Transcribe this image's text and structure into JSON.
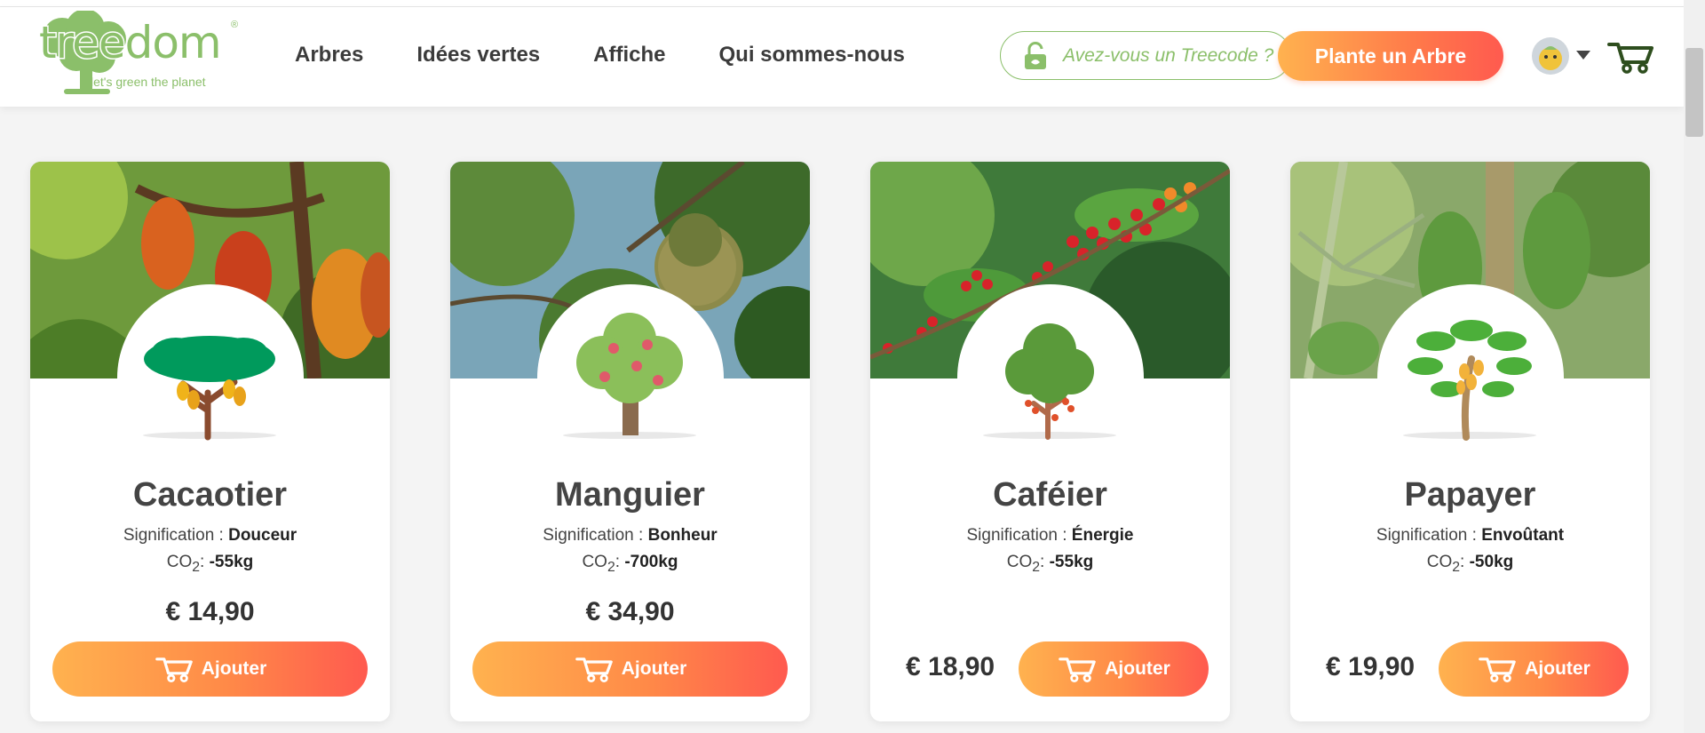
{
  "brand": {
    "name": "treedom",
    "tagline": "let's green the planet",
    "registered": "®",
    "color": "#8bbf6a"
  },
  "nav": {
    "items": [
      "Arbres",
      "Idées vertes",
      "Affiche",
      "Qui sommes-nous"
    ]
  },
  "header": {
    "treecode_label": "Avez-vous un Treecode ?",
    "plant_button": "Plante un Arbre",
    "accent": "#ff7a4a"
  },
  "cards": [
    {
      "name": "Cacaotier",
      "meaning_label": "Signification : ",
      "meaning": "Douceur",
      "co2_label": "CO",
      "co2_sub": "2",
      "co2_sep": ": ",
      "co2": "-55kg",
      "price": "€ 14,90",
      "button": "Ajouter",
      "icon": "cacao-tree-icon"
    },
    {
      "name": "Manguier",
      "meaning_label": "Signification : ",
      "meaning": "Bonheur",
      "co2_label": "CO",
      "co2_sub": "2",
      "co2_sep": ": ",
      "co2": "-700kg",
      "price": "€ 34,90",
      "button": "Ajouter",
      "icon": "mango-tree-icon"
    },
    {
      "name": "Caféier",
      "meaning_label": "Signification : ",
      "meaning": "Énergie",
      "co2_label": "CO",
      "co2_sub": "2",
      "co2_sep": ": ",
      "co2": "-55kg",
      "price": "€ 18,90",
      "button": "Ajouter",
      "icon": "coffee-tree-icon"
    },
    {
      "name": "Papayer",
      "meaning_label": "Signification : ",
      "meaning": "Envoûtant",
      "co2_label": "CO",
      "co2_sub": "2",
      "co2_sep": ": ",
      "co2": "-50kg",
      "price": "€ 19,90",
      "button": "Ajouter",
      "icon": "papaya-tree-icon"
    }
  ]
}
